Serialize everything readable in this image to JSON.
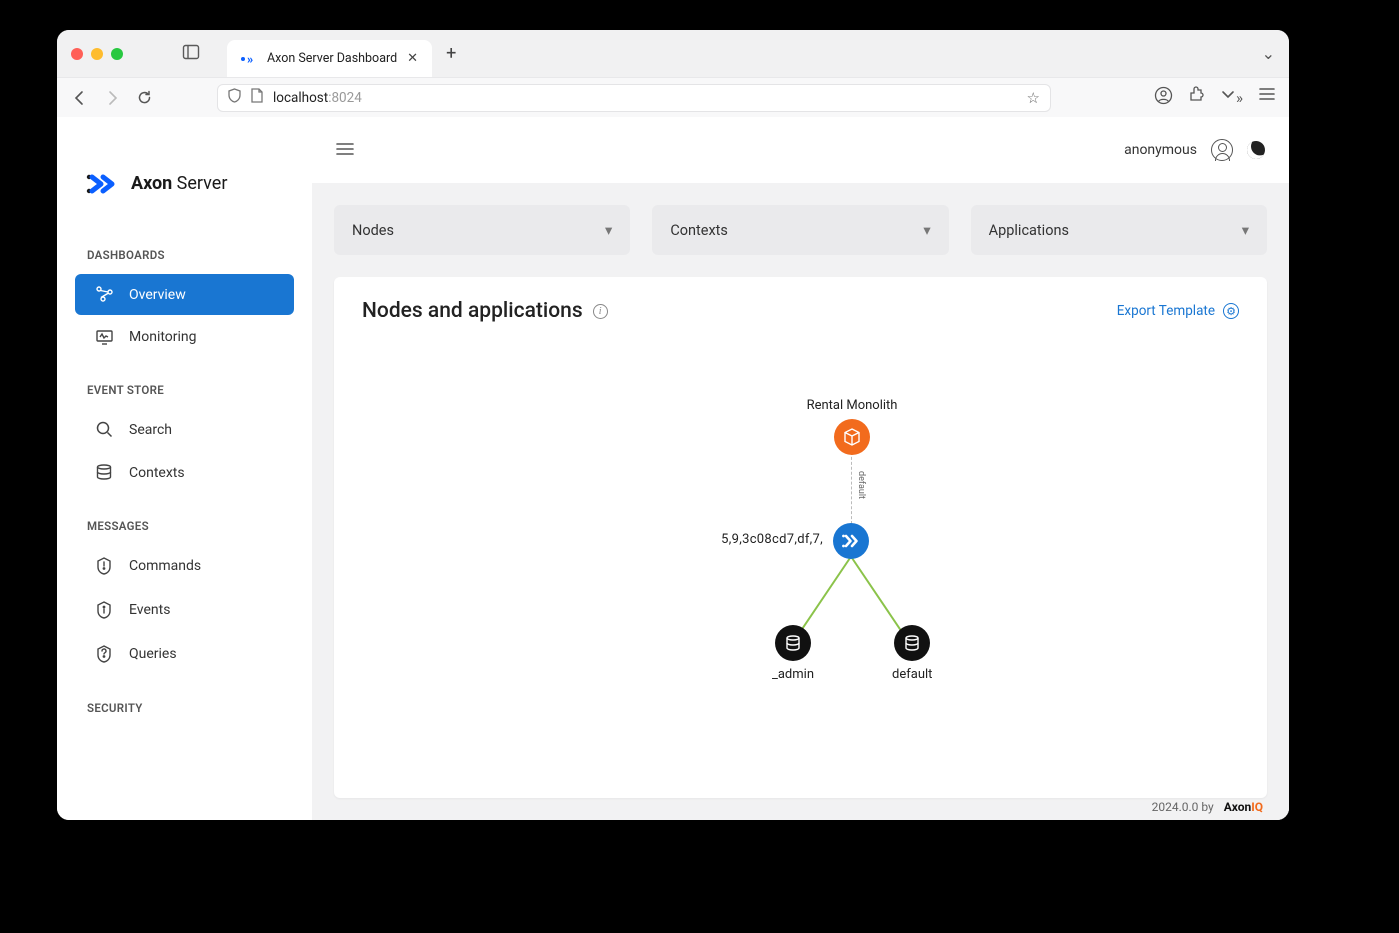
{
  "browser": {
    "tab_title": "Axon Server Dashboard",
    "url_host": "localhost",
    "url_port": ":8024"
  },
  "product": {
    "name_bold": "Axon",
    "name_light": " Server"
  },
  "sidebar": {
    "sections": [
      {
        "heading": "DASHBOARDS",
        "items": [
          {
            "label": "Overview",
            "active": true
          },
          {
            "label": "Monitoring",
            "active": false
          }
        ]
      },
      {
        "heading": "EVENT STORE",
        "items": [
          {
            "label": "Search"
          },
          {
            "label": "Contexts"
          }
        ]
      },
      {
        "heading": "MESSAGES",
        "items": [
          {
            "label": "Commands"
          },
          {
            "label": "Events"
          },
          {
            "label": "Queries"
          }
        ]
      },
      {
        "heading": "SECURITY",
        "items": []
      }
    ]
  },
  "topbar": {
    "user": "anonymous"
  },
  "filters": {
    "nodes": "Nodes",
    "contexts": "Contexts",
    "applications": "Applications"
  },
  "panel": {
    "title": "Nodes and applications",
    "export": "Export Template"
  },
  "graph": {
    "app": {
      "label": "Rental Monolith"
    },
    "app_edge_label": "default",
    "server": {
      "label": "5,9,3c08cd7,df,7,"
    },
    "ctx1": {
      "label": "_admin"
    },
    "ctx2": {
      "label": "default"
    }
  },
  "footer": {
    "version": "2024.0.0 by",
    "brand": "Axon",
    "iq": "IQ"
  }
}
